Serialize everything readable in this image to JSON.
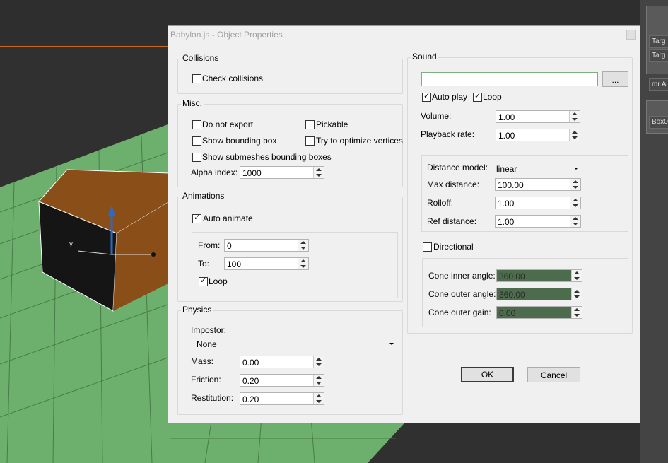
{
  "dialog": {
    "title": "Babylon.js - Object Properties"
  },
  "collisions": {
    "label": "Collisions",
    "check_collisions": {
      "label": "Check collisions",
      "checked": false
    }
  },
  "misc": {
    "label": "Misc.",
    "do_not_export": {
      "label": "Do not export",
      "checked": false
    },
    "pickable": {
      "label": "Pickable",
      "checked": false
    },
    "show_bounding_box": {
      "label": "Show bounding box",
      "checked": false
    },
    "optimize_vertices": {
      "label": "Try to optimize vertices",
      "checked": false
    },
    "show_submeshes": {
      "label": "Show submeshes bounding boxes",
      "checked": false
    },
    "alpha_index": {
      "label": "Alpha index:",
      "value": "1000"
    }
  },
  "animations": {
    "label": "Animations",
    "auto_animate": {
      "label": "Auto animate",
      "checked": true
    },
    "from": {
      "label": "From:",
      "value": "0"
    },
    "to": {
      "label": "To:",
      "value": "100"
    },
    "loop": {
      "label": "Loop",
      "checked": true
    }
  },
  "physics": {
    "label": "Physics",
    "impostor": {
      "label": "Impostor:",
      "value": "None"
    },
    "mass": {
      "label": "Mass:",
      "value": "0.00"
    },
    "friction": {
      "label": "Friction:",
      "value": "0.20"
    },
    "restitution": {
      "label": "Restitution:",
      "value": "0.20"
    }
  },
  "sound": {
    "label": "Sound",
    "file": {
      "value": ""
    },
    "browse_label": "...",
    "auto_play": {
      "label": "Auto play",
      "checked": true
    },
    "loop": {
      "label": "Loop",
      "checked": true
    },
    "volume": {
      "label": "Volume:",
      "value": "1.00"
    },
    "playback_rate": {
      "label": "Playback rate:",
      "value": "1.00"
    },
    "distance_model": {
      "label": "Distance model:",
      "value": "linear"
    },
    "max_distance": {
      "label": "Max distance:",
      "value": "100.00"
    },
    "rolloff": {
      "label": "Rolloff:",
      "value": "1.00"
    },
    "ref_distance": {
      "label": "Ref distance:",
      "value": "1.00"
    },
    "directional": {
      "label": "Directional",
      "checked": false
    },
    "cone_inner_angle": {
      "label": "Cone inner angle:",
      "value": "360.00"
    },
    "cone_outer_angle": {
      "label": "Cone outer angle:",
      "value": "360.00"
    },
    "cone_outer_gain": {
      "label": "Cone outer gain:",
      "value": "0.00"
    }
  },
  "buttons": {
    "ok": "OK",
    "cancel": "Cancel"
  },
  "right_panel": {
    "buttons": [
      "Targ",
      "Targ",
      "mr A",
      "Box0"
    ]
  },
  "viewport": {
    "axis_label": "y"
  },
  "colors": {
    "ground": "#6db06d",
    "box": "#8a4e18",
    "gizmo": "#2a6ac8"
  }
}
